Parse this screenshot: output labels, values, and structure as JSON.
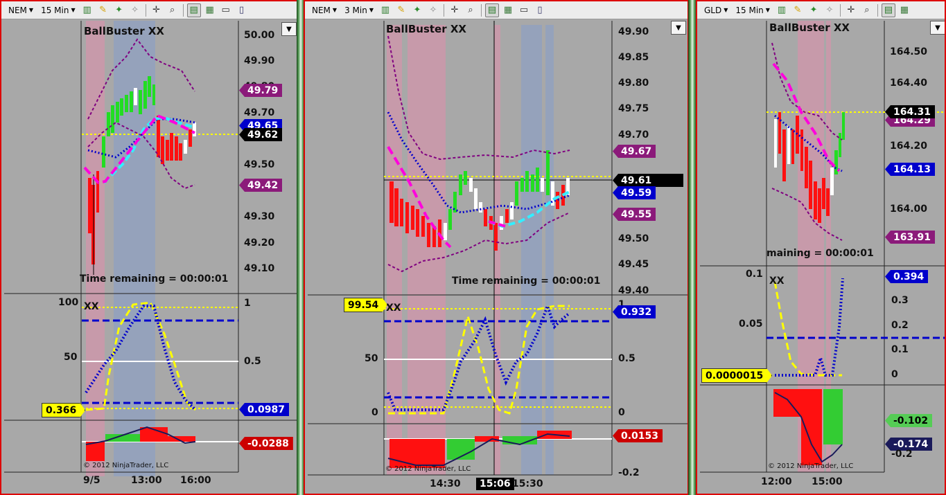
{
  "windows": [
    {
      "toolbar": {
        "instrument": "NEM",
        "interval": "15 Min"
      },
      "indicator_title": "BallBuster XX",
      "remaining": "Time remaining = 00:00:01",
      "price_axis": [
        "50.00",
        "49.90",
        "49.80",
        "49.70",
        "49.60",
        "49.50",
        "49.40",
        "49.30",
        "49.20",
        "49.10"
      ],
      "price_tags": [
        {
          "value": "49.79",
          "color": "#8b1a7a"
        },
        {
          "value": "49.65",
          "color": "#0000cc"
        },
        {
          "value": "49.62",
          "color": "#000000"
        },
        {
          "value": "49.42",
          "color": "#8b1a7a"
        }
      ],
      "osc_left_axis": [
        "100",
        "50"
      ],
      "osc_right_axis": [
        "1",
        "0.5"
      ],
      "osc_title": "XX",
      "osc_tags": [
        {
          "value": "0.0987",
          "color": "#0000cc"
        }
      ],
      "osc_left_tag": "0.366",
      "macd_tag": {
        "value": "-0.0288",
        "color": "#cc0000"
      },
      "copyright": "© 2012 NinjaTrader, LLC",
      "time_axis": [
        "9/5",
        "13:00",
        "16:00"
      ]
    },
    {
      "toolbar": {
        "instrument": "NEM",
        "interval": "3 Min"
      },
      "indicator_title": "BallBuster XX",
      "remaining": "Time remaining = 00:00:01",
      "price_axis": [
        "49.90",
        "49.85",
        "49.80",
        "49.75",
        "49.70",
        "49.65",
        "49.60",
        "49.55",
        "49.50",
        "49.45",
        "49.40"
      ],
      "price_tags": [
        {
          "value": "49.67",
          "color": "#8b1a7a"
        },
        {
          "value": "49.61",
          "color": "#000000"
        },
        {
          "value": "49.59",
          "color": "#0000cc"
        },
        {
          "value": "49.55",
          "color": "#8b1a7a"
        }
      ],
      "osc_left_axis": [
        "50",
        "0"
      ],
      "osc_right_axis": [
        "1",
        "0.5",
        "0"
      ],
      "osc_title": "XX",
      "osc_tags": [
        {
          "value": "0.932",
          "color": "#0000cc"
        }
      ],
      "osc_left_tag": "99.54",
      "macd_tag": {
        "value": "0.0153",
        "color": "#cc0000"
      },
      "macd_axis": [
        "-0.2"
      ],
      "copyright": "© 2012 NinjaTrader, LLC",
      "time_axis": [
        "14:30",
        "15:06",
        "15:30"
      ]
    },
    {
      "toolbar": {
        "instrument": "GLD",
        "interval": "15 Min"
      },
      "indicator_title": "BallBuster XX",
      "remaining": "maining = 00:00:01",
      "price_axis": [
        "164.50",
        "164.40",
        "164.30",
        "164.20",
        "164.10",
        "164.00"
      ],
      "price_tags": [
        {
          "value": "164.31",
          "color": "#000000"
        },
        {
          "value": "164.29",
          "color": "#8b1a7a"
        },
        {
          "value": "164.13",
          "color": "#0000cc"
        },
        {
          "value": "163.91",
          "color": "#8b1a7a"
        }
      ],
      "osc_left_axis": [
        "0.1",
        "0.05"
      ],
      "osc_right_axis": [
        "0.3",
        "0.2",
        "0.1",
        "0"
      ],
      "osc_title": "XX",
      "osc_tags": [
        {
          "value": "0.394",
          "color": "#0000cc"
        }
      ],
      "osc_left_tag": "0.0000015",
      "macd_tags": [
        {
          "value": "-0.102",
          "color": "#2e8b2e"
        },
        {
          "value": "-0.174",
          "color": "#1a1a5a"
        }
      ],
      "macd_axis": [
        "-0.2"
      ],
      "copyright": "© 2012 NinjaTrader, LLC",
      "time_axis": [
        "12:00",
        "15:00"
      ]
    }
  ],
  "icons": [
    "bar-chart-type-icon",
    "draw-pencil-icon",
    "attach-indicator-icon",
    "strategy-icon",
    "crosshair-icon",
    "zoom-icon",
    "data-box-icon",
    "chart-trader-icon",
    "properties-icon",
    "edit-icon"
  ]
}
